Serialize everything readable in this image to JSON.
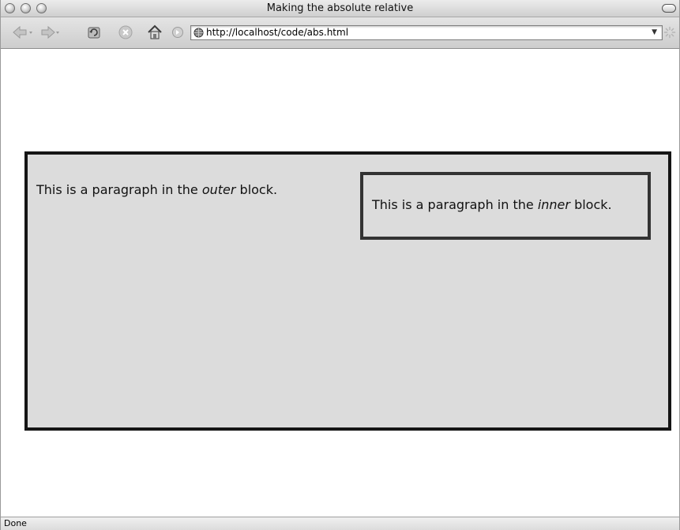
{
  "window": {
    "title": "Making the absolute relative"
  },
  "toolbar": {
    "url": "http://localhost/code/abs.html",
    "icons": [
      "back-arrow-icon",
      "forward-arrow-icon",
      "reload-icon",
      "stop-icon",
      "home-icon",
      "go-icon",
      "globe-icon",
      "dropdown-arrow-icon",
      "throbber-icon"
    ]
  },
  "page": {
    "outer": {
      "text_before": "This is a paragraph in the ",
      "emphasis": "outer",
      "text_after": " block."
    },
    "inner": {
      "text_before": "This is a paragraph in the ",
      "emphasis": "inner",
      "text_after": " block."
    }
  },
  "statusbar": {
    "text": "Done"
  },
  "colors": {
    "block_background": "#dcdcdc",
    "outer_border": "#151515",
    "inner_border": "#333333"
  }
}
